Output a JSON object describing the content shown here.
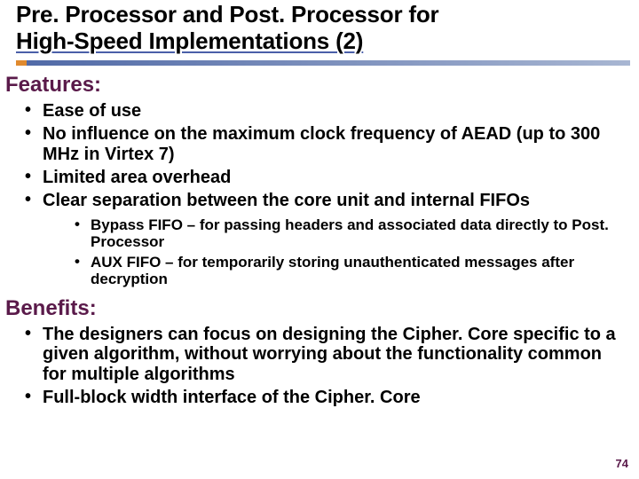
{
  "title_line1": "Pre. Processor and Post. Processor for",
  "title_line2": "High-Speed Implementations (2)",
  "sections": {
    "features": {
      "heading": "Features:",
      "items": [
        "Ease of use",
        "No influence on the maximum clock frequency of AEAD (up to 300 MHz in Virtex 7)",
        "Limited area overhead",
        "Clear separation between the core unit and internal FIFOs"
      ],
      "subitems": [
        "Bypass FIFO – for passing headers and associated data directly to Post. Processor",
        "AUX FIFO – for temporarily storing unauthenticated messages after decryption"
      ]
    },
    "benefits": {
      "heading": "Benefits:",
      "items": [
        "The designers can focus on designing the Cipher. Core specific to a given algorithm, without worrying about the functionality common for multiple algorithms",
        "Full-block width interface of the Cipher. Core"
      ]
    }
  },
  "page_number": "74"
}
